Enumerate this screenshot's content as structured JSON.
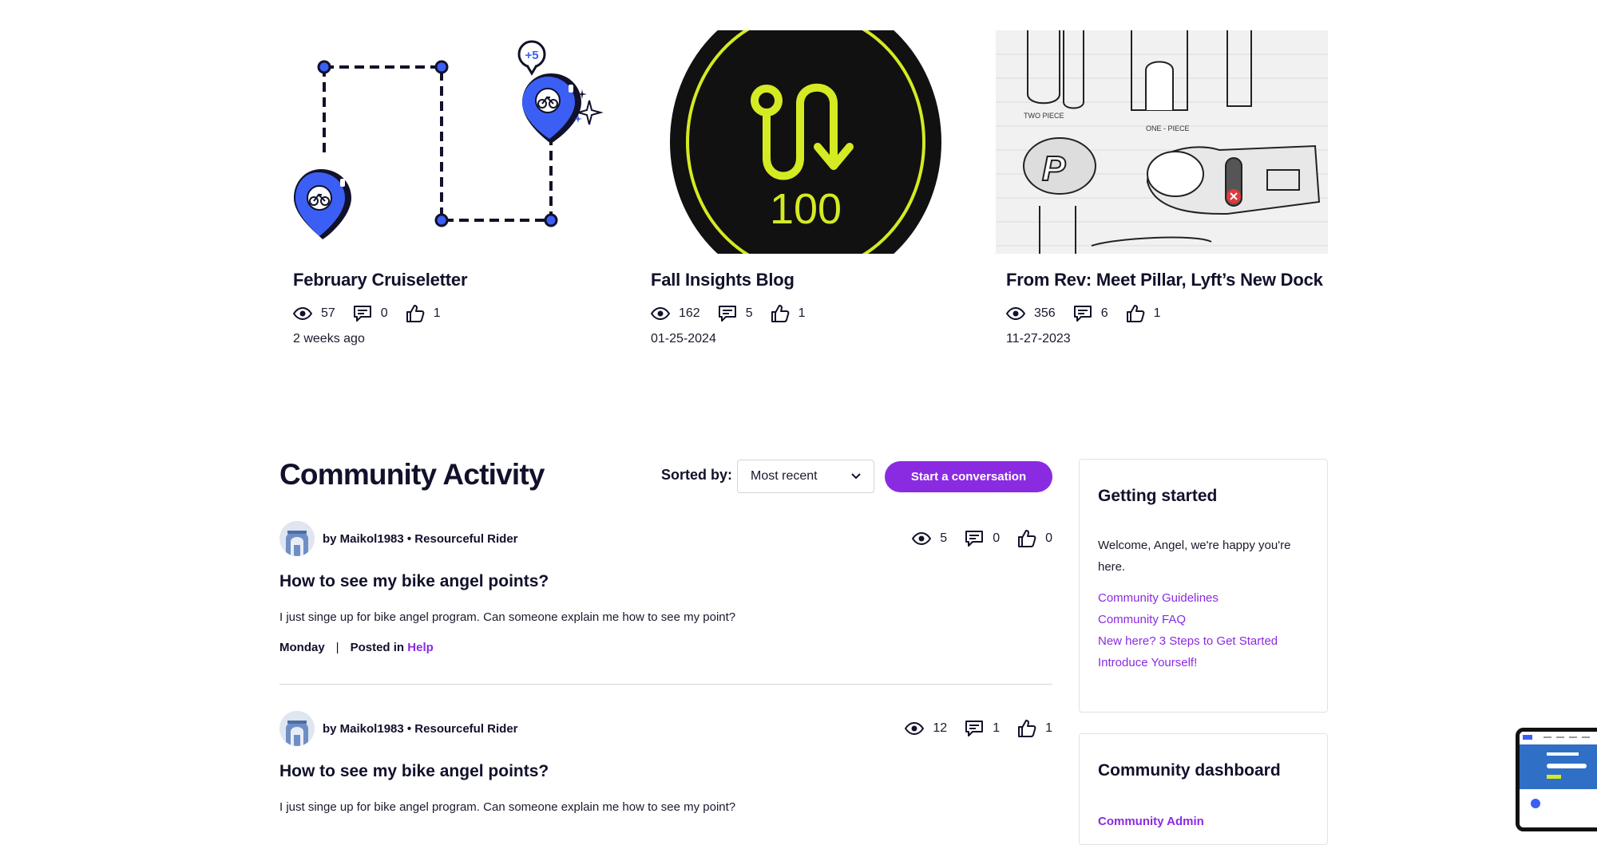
{
  "cards": [
    {
      "title": "February Cruiseletter",
      "views": "57",
      "comments": "0",
      "likes": "1",
      "date": "2 weeks ago",
      "thumb_badge": "+5"
    },
    {
      "title": "Fall Insights Blog",
      "views": "162",
      "comments": "5",
      "likes": "1",
      "date": "01-25-2024",
      "thumb_label": "100"
    },
    {
      "title": "From Rev: Meet Pillar, Lyft’s New Dock",
      "views": "356",
      "comments": "6",
      "likes": "1",
      "date": "11-27-2023",
      "sketch_notes": [
        "TWO PIECE",
        "ONE - PIECE"
      ]
    }
  ],
  "community": {
    "title": "Community Activity",
    "sorted_label": "Sorted by:",
    "sort_value": "Most recent",
    "start_button": "Start a conversation",
    "posts": [
      {
        "author": "by Maikol1983 • Resourceful Rider",
        "views": "5",
        "comments": "0",
        "likes": "0",
        "title": "How to see my bike angel points?",
        "body": "I just singe up for bike angel program. Can someone explain me how to see my point?",
        "day": "Monday",
        "sep": "|",
        "posted_in": "Posted in",
        "board": "Help"
      },
      {
        "author": "by Maikol1983 • Resourceful Rider",
        "views": "12",
        "comments": "1",
        "likes": "1",
        "title": "How to see my bike angel points?",
        "body": "I just singe up for bike angel program. Can someone explain me how to see my point?"
      }
    ]
  },
  "sidebar": {
    "getting_started": {
      "title": "Getting started",
      "welcome": "Welcome, Angel, we're happy you're here.",
      "links": [
        "Community Guidelines",
        "Community FAQ",
        "New here? 3 Steps to Get Started",
        "Introduce Yourself!"
      ]
    },
    "dashboard": {
      "title": "Community dashboard",
      "first_link": "Community Admin"
    }
  },
  "colors": {
    "accent": "#8a2be2",
    "pin_blue": "#3b5ff5",
    "neon_yellow": "#d4ea23",
    "text_dark": "#11112b"
  },
  "icons": [
    "eye-icon",
    "comment-icon",
    "thumbs-up-icon",
    "chevron-down-icon",
    "map-pin-icon",
    "bike-icon",
    "sparkle-icon"
  ]
}
